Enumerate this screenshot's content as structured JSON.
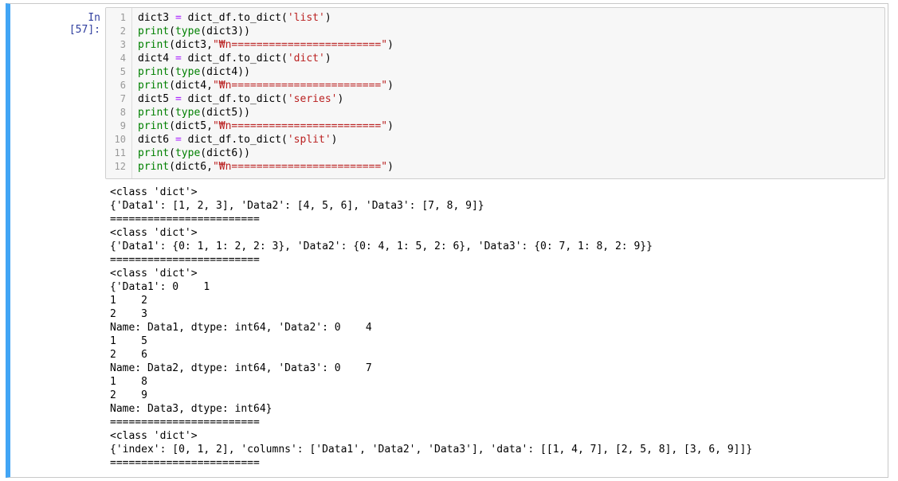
{
  "cell": {
    "prompt": "In [57]:",
    "code_lines": [
      {
        "n": "1",
        "parts": [
          [
            "var",
            "dict3 "
          ],
          [
            "op",
            "="
          ],
          [
            "plain",
            " dict_df.to_dict("
          ],
          [
            "str",
            "'list'"
          ],
          [
            "plain",
            ")"
          ]
        ]
      },
      {
        "n": "2",
        "parts": [
          [
            "kw",
            "print"
          ],
          [
            "plain",
            "("
          ],
          [
            "kw",
            "type"
          ],
          [
            "plain",
            "(dict3))"
          ]
        ]
      },
      {
        "n": "3",
        "parts": [
          [
            "kw",
            "print"
          ],
          [
            "plain",
            "(dict3,"
          ],
          [
            "str",
            "\"₩n========================\""
          ],
          [
            "plain",
            ")"
          ]
        ]
      },
      {
        "n": "4",
        "parts": [
          [
            "var",
            "dict4 "
          ],
          [
            "op",
            "="
          ],
          [
            "plain",
            " dict_df.to_dict("
          ],
          [
            "str",
            "'dict'"
          ],
          [
            "plain",
            ")"
          ]
        ]
      },
      {
        "n": "5",
        "parts": [
          [
            "kw",
            "print"
          ],
          [
            "plain",
            "("
          ],
          [
            "kw",
            "type"
          ],
          [
            "plain",
            "(dict4))"
          ]
        ]
      },
      {
        "n": "6",
        "parts": [
          [
            "kw",
            "print"
          ],
          [
            "plain",
            "(dict4,"
          ],
          [
            "str",
            "\"₩n========================\""
          ],
          [
            "plain",
            ")"
          ]
        ]
      },
      {
        "n": "7",
        "parts": [
          [
            "var",
            "dict5 "
          ],
          [
            "op",
            "="
          ],
          [
            "plain",
            " dict_df.to_dict("
          ],
          [
            "str",
            "'series'"
          ],
          [
            "plain",
            ")"
          ]
        ]
      },
      {
        "n": "8",
        "parts": [
          [
            "kw",
            "print"
          ],
          [
            "plain",
            "("
          ],
          [
            "kw",
            "type"
          ],
          [
            "plain",
            "(dict5))"
          ]
        ]
      },
      {
        "n": "9",
        "parts": [
          [
            "kw",
            "print"
          ],
          [
            "plain",
            "(dict5,"
          ],
          [
            "str",
            "\"₩n========================\""
          ],
          [
            "plain",
            ")"
          ]
        ]
      },
      {
        "n": "10",
        "parts": [
          [
            "var",
            "dict6 "
          ],
          [
            "op",
            "="
          ],
          [
            "plain",
            " dict_df.to_dict("
          ],
          [
            "str",
            "'split'"
          ],
          [
            "plain",
            ")"
          ]
        ]
      },
      {
        "n": "11",
        "parts": [
          [
            "kw",
            "print"
          ],
          [
            "plain",
            "("
          ],
          [
            "kw",
            "type"
          ],
          [
            "plain",
            "(dict6))"
          ]
        ]
      },
      {
        "n": "12",
        "parts": [
          [
            "kw",
            "print"
          ],
          [
            "plain",
            "(dict6,"
          ],
          [
            "str",
            "\"₩n========================\""
          ],
          [
            "plain",
            ")"
          ]
        ]
      }
    ],
    "output_lines": [
      "<class 'dict'>",
      "{'Data1': [1, 2, 3], 'Data2': [4, 5, 6], 'Data3': [7, 8, 9]}",
      "========================",
      "<class 'dict'>",
      "{'Data1': {0: 1, 1: 2, 2: 3}, 'Data2': {0: 4, 1: 5, 2: 6}, 'Data3': {0: 7, 1: 8, 2: 9}}",
      "========================",
      "<class 'dict'>",
      "{'Data1': 0    1",
      "1    2",
      "2    3",
      "Name: Data1, dtype: int64, 'Data2': 0    4",
      "1    5",
      "2    6",
      "Name: Data2, dtype: int64, 'Data3': 0    7",
      "1    8",
      "2    9",
      "Name: Data3, dtype: int64}",
      "========================",
      "<class 'dict'>",
      "{'index': [0, 1, 2], 'columns': ['Data1', 'Data2', 'Data3'], 'data': [[1, 4, 7], [2, 5, 8], [3, 6, 9]]}",
      "========================"
    ]
  },
  "colors": {
    "selected_border": "#42a5f5",
    "prompt": "#303f9f",
    "keyword": "#008000",
    "string": "#ba2121",
    "operator": "#aa22ff"
  }
}
